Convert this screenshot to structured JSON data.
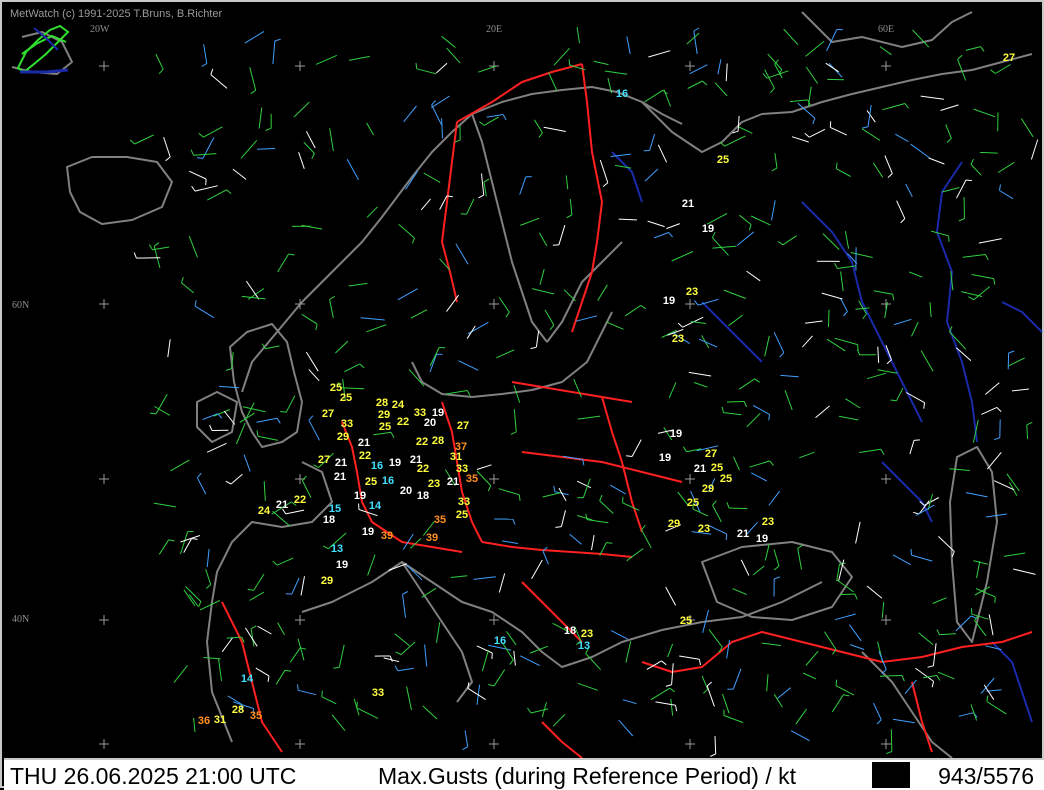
{
  "header": {
    "copyright": "MetWatch  (c) 1991-2025 T.Bruns, B.Richter"
  },
  "grid_labels": {
    "lon_20w": "20W",
    "lon_20e": "20E",
    "lon_60e": "60E",
    "lat_60n": "60N",
    "lat_40n": "40N"
  },
  "status": {
    "datetime": "THU 26.06.2025 21:00 UTC",
    "parameter": "Max.Gusts (during Reference Period) / kt",
    "station_count": "943/5576"
  },
  "colors": {
    "background": "#000000",
    "coastline": "#808080",
    "borders": "#ff2020",
    "rivers_lakes": "#1a2aa8",
    "gust_white": "#ffffff",
    "gust_yellow": "#ffff40",
    "gust_cyan": "#40e0ff",
    "gust_orange": "#ff9020",
    "barb_green": "#30d040",
    "barb_cyan": "#40a0ff"
  },
  "gust_labels": [
    {
      "v": "27",
      "c": "yellow"
    },
    {
      "v": "16",
      "c": "cyan"
    },
    {
      "v": "25",
      "c": "yellow"
    },
    {
      "v": "21",
      "c": "white"
    },
    {
      "v": "19",
      "c": "white"
    },
    {
      "v": "19",
      "c": "white"
    },
    {
      "v": "23",
      "c": "yellow"
    },
    {
      "v": "23",
      "c": "yellow"
    },
    {
      "v": "25",
      "c": "yellow"
    },
    {
      "v": "25",
      "c": "yellow"
    },
    {
      "v": "28",
      "c": "yellow"
    },
    {
      "v": "24",
      "c": "yellow"
    },
    {
      "v": "27",
      "c": "yellow"
    },
    {
      "v": "33",
      "c": "yellow"
    },
    {
      "v": "29",
      "c": "yellow"
    },
    {
      "v": "33",
      "c": "yellow"
    },
    {
      "v": "19",
      "c": "white"
    },
    {
      "v": "25",
      "c": "yellow"
    },
    {
      "v": "22",
      "c": "yellow"
    },
    {
      "v": "20",
      "c": "white"
    },
    {
      "v": "27",
      "c": "yellow"
    },
    {
      "v": "29",
      "c": "yellow"
    },
    {
      "v": "21",
      "c": "white"
    },
    {
      "v": "22",
      "c": "yellow"
    },
    {
      "v": "28",
      "c": "yellow"
    },
    {
      "v": "37",
      "c": "orange"
    },
    {
      "v": "27",
      "c": "yellow"
    },
    {
      "v": "21",
      "c": "white"
    },
    {
      "v": "22",
      "c": "yellow"
    },
    {
      "v": "16",
      "c": "cyan"
    },
    {
      "v": "19",
      "c": "white"
    },
    {
      "v": "21",
      "c": "white"
    },
    {
      "v": "31",
      "c": "yellow"
    },
    {
      "v": "21",
      "c": "white"
    },
    {
      "v": "22",
      "c": "yellow"
    },
    {
      "v": "33",
      "c": "yellow"
    },
    {
      "v": "25",
      "c": "yellow"
    },
    {
      "v": "16",
      "c": "cyan"
    },
    {
      "v": "35",
      "c": "orange"
    },
    {
      "v": "23",
      "c": "yellow"
    },
    {
      "v": "21",
      "c": "white"
    },
    {
      "v": "20",
      "c": "white"
    },
    {
      "v": "18",
      "c": "white"
    },
    {
      "v": "19",
      "c": "white"
    },
    {
      "v": "33",
      "c": "yellow"
    },
    {
      "v": "22",
      "c": "yellow"
    },
    {
      "v": "21",
      "c": "white"
    },
    {
      "v": "24",
      "c": "yellow"
    },
    {
      "v": "15",
      "c": "cyan"
    },
    {
      "v": "14",
      "c": "cyan"
    },
    {
      "v": "18",
      "c": "white"
    },
    {
      "v": "25",
      "c": "yellow"
    },
    {
      "v": "35",
      "c": "orange"
    },
    {
      "v": "19",
      "c": "white"
    },
    {
      "v": "39",
      "c": "orange"
    },
    {
      "v": "39",
      "c": "orange"
    },
    {
      "v": "13",
      "c": "cyan"
    },
    {
      "v": "19",
      "c": "white"
    },
    {
      "v": "29",
      "c": "yellow"
    },
    {
      "v": "19",
      "c": "white"
    },
    {
      "v": "19",
      "c": "white"
    },
    {
      "v": "27",
      "c": "yellow"
    },
    {
      "v": "21",
      "c": "white"
    },
    {
      "v": "25",
      "c": "yellow"
    },
    {
      "v": "25",
      "c": "yellow"
    },
    {
      "v": "29",
      "c": "yellow"
    },
    {
      "v": "25",
      "c": "yellow"
    },
    {
      "v": "29",
      "c": "yellow"
    },
    {
      "v": "23",
      "c": "yellow"
    },
    {
      "v": "21",
      "c": "white"
    },
    {
      "v": "23",
      "c": "yellow"
    },
    {
      "v": "19",
      "c": "white"
    },
    {
      "v": "25",
      "c": "yellow"
    },
    {
      "v": "18",
      "c": "white"
    },
    {
      "v": "23",
      "c": "yellow"
    },
    {
      "v": "13",
      "c": "cyan"
    },
    {
      "v": "16",
      "c": "cyan"
    },
    {
      "v": "14",
      "c": "cyan"
    },
    {
      "v": "33",
      "c": "yellow"
    },
    {
      "v": "36",
      "c": "orange"
    },
    {
      "v": "31",
      "c": "yellow"
    },
    {
      "v": "28",
      "c": "yellow"
    },
    {
      "v": "35",
      "c": "orange"
    }
  ]
}
